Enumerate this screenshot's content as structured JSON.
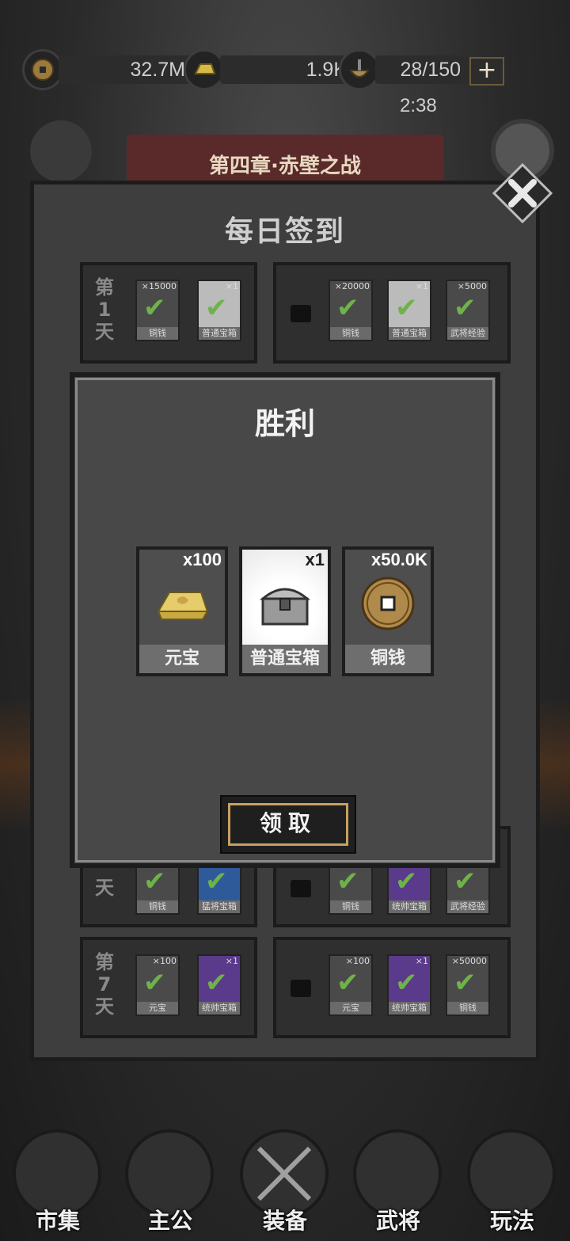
{
  "resources": {
    "coins": "32.7M",
    "gold": "1.9K",
    "stamina": "28/150",
    "plus": "+",
    "timer": "2:38"
  },
  "chapter": "第四章·赤壁之战",
  "signin": {
    "title": "每日签到",
    "day1": {
      "label": "第1天",
      "items": [
        {
          "name": "铜钱",
          "qty": "×15000"
        },
        {
          "name": "普通宝箱",
          "qty": "×1"
        }
      ],
      "video_items": [
        {
          "name": "铜钱",
          "qty": "×20000"
        },
        {
          "name": "普通宝箱",
          "qty": "×1"
        },
        {
          "name": "武将经验",
          "qty": "×5000"
        }
      ]
    },
    "day6": {
      "label_tail": "天",
      "items": [
        {
          "name": "铜钱",
          "qty": ""
        },
        {
          "name": "猛将宝箱",
          "qty": ""
        }
      ],
      "video_items": [
        {
          "name": "铜钱",
          "qty": ""
        },
        {
          "name": "统帅宝箱",
          "qty": ""
        },
        {
          "name": "武将经验",
          "qty": ""
        }
      ]
    },
    "day7": {
      "label": "第7天",
      "items": [
        {
          "name": "元宝",
          "qty": "×100"
        },
        {
          "name": "统帅宝箱",
          "qty": "×1"
        }
      ],
      "video_items": [
        {
          "name": "元宝",
          "qty": "×100"
        },
        {
          "name": "统帅宝箱",
          "qty": "×1"
        },
        {
          "name": "铜钱",
          "qty": "×50000"
        }
      ]
    }
  },
  "victory": {
    "title": "胜利",
    "rewards": [
      {
        "name": "元宝",
        "qty": "x100"
      },
      {
        "name": "普通宝箱",
        "qty": "x1"
      },
      {
        "name": "铜钱",
        "qty": "x50.0K"
      }
    ],
    "claim_label": "领取"
  },
  "nav": [
    "市集",
    "主公",
    "装备",
    "武将",
    "玩法"
  ],
  "colors": {
    "check": "#6fb24a",
    "claim_border": "#c9a062",
    "chapter_banner": "#5a2a2a"
  }
}
